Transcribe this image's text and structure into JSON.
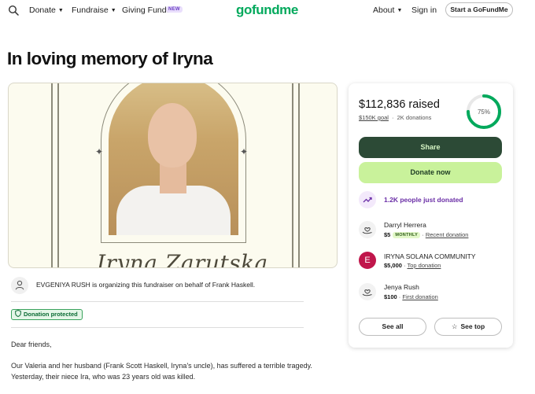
{
  "nav": {
    "donate_label": "Donate",
    "fundraise_label": "Fundraise",
    "giving_funds_label": "Giving Funds",
    "new_badge": "NEW",
    "logo_text": "gofundme",
    "about_label": "About",
    "sign_in_label": "Sign in",
    "start_button": "Start a GoFundMe"
  },
  "page": {
    "title": "In loving memory of Iryna",
    "hero_name": "Iryna Zarutska"
  },
  "organizer": {
    "text": "EVGENIYA RUSH is organizing this fundraiser on behalf of Frank Haskell."
  },
  "protected_badge": "Donation protected",
  "story": {
    "greeting": "Dear friends,",
    "paragraph_1": "Our Valeria and her husband (Frank Scott Haskell, Iryna's uncle), has suffered a terrible tragedy. Yesterday, their niece Ira, who was 23 years old was killed."
  },
  "card": {
    "raised_amount": "$112,836",
    "raised_label": " raised",
    "goal": "$150K goal",
    "donations_count": "2K donations",
    "progress_percent": 75,
    "progress_label": "75%",
    "share_label": "Share",
    "donate_label": "Donate now",
    "trend_text": "1.2K people just donated",
    "donors": [
      {
        "name": "Darryl Herrera",
        "amount": "$5",
        "badge": "MONTHLY",
        "tag": "Recent donation",
        "icon": "heart-hand-icon"
      },
      {
        "name": "IRYNA SOLANA COMMUNITY",
        "amount": "$5,000",
        "tag": "Top donation",
        "initial": "E"
      },
      {
        "name": "Jenya Rush",
        "amount": "$100",
        "tag": "First donation",
        "icon": "heart-hand-icon"
      }
    ],
    "see_all_label": "See all",
    "see_top_label": "See top"
  },
  "colors": {
    "brand_green": "#02a95c",
    "share_bg": "#2c4a36",
    "donate_bg": "#c9f29b",
    "trend_purple": "#6a2ea6"
  }
}
